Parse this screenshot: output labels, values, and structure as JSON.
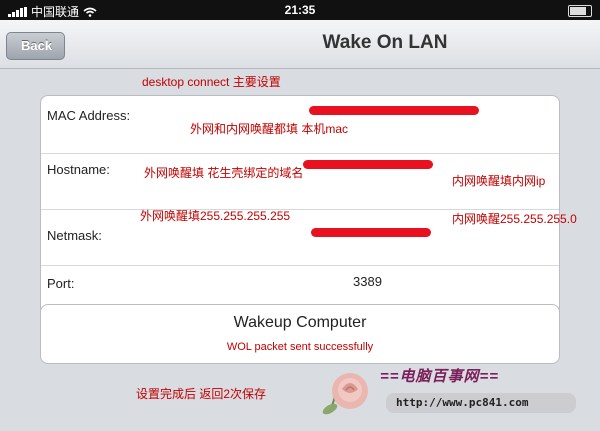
{
  "status_bar": {
    "carrier": "中国联通",
    "time": "21:35"
  },
  "nav": {
    "back_label": "Back",
    "title": "Wake On LAN"
  },
  "annotations": {
    "header_note": "desktop connect 主要设置",
    "mac_note": "外网和内网唤醒都填 本机mac",
    "hostname_wan_note": "外网唤醒填 花生壳绑定的域名",
    "hostname_lan_note": "内网唤醒填内网ip",
    "netmask_wan_note": "外网唤醒填255.255.255.255",
    "netmask_lan_note": "内网唤醒255.255.255.0",
    "footer_note": "设置完成后 返回2次保存"
  },
  "form": {
    "fields": [
      {
        "label": "MAC Address:",
        "value": ""
      },
      {
        "label": "Hostname:",
        "value": ""
      },
      {
        "label": "Netmask:",
        "value": ""
      },
      {
        "label": "Port:",
        "value": "3389"
      }
    ]
  },
  "wakeup": {
    "button_label": "Wakeup Computer",
    "status_text": "WOL packet sent successfully"
  },
  "watermark": {
    "title": "==电脑百事网==",
    "url": "http://www.pc841.com"
  },
  "colors": {
    "annotation_red": "#c40000",
    "redaction_red": "#e8111f",
    "background": "#d9dce1"
  }
}
